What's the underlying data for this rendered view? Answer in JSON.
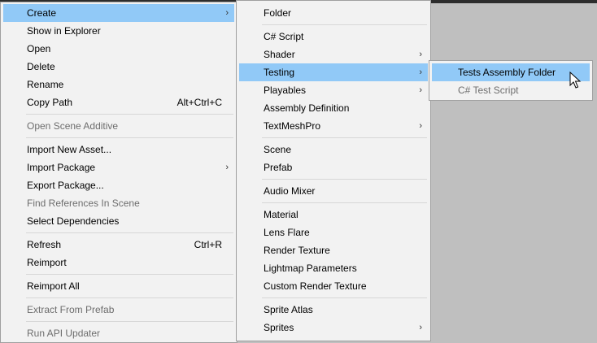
{
  "main_menu": {
    "items": [
      {
        "label": "Create",
        "arrow": "›"
      },
      {
        "label": "Show in Explorer"
      },
      {
        "label": "Open"
      },
      {
        "label": "Delete"
      },
      {
        "label": "Rename"
      },
      {
        "label": "Copy Path",
        "shortcut": "Alt+Ctrl+C"
      },
      {
        "label": "Open Scene Additive"
      },
      {
        "label": "Import New Asset..."
      },
      {
        "label": "Import Package",
        "arrow": "›"
      },
      {
        "label": "Export Package..."
      },
      {
        "label": "Find References In Scene"
      },
      {
        "label": "Select Dependencies"
      },
      {
        "label": "Refresh",
        "shortcut": "Ctrl+R"
      },
      {
        "label": "Reimport"
      },
      {
        "label": "Reimport All"
      },
      {
        "label": "Extract From Prefab"
      },
      {
        "label": "Run API Updater"
      }
    ]
  },
  "create_menu": {
    "items": [
      {
        "label": "Folder"
      },
      {
        "label": "C# Script"
      },
      {
        "label": "Shader",
        "arrow": "›"
      },
      {
        "label": "Testing",
        "arrow": "›"
      },
      {
        "label": "Playables",
        "arrow": "›"
      },
      {
        "label": "Assembly Definition"
      },
      {
        "label": "TextMeshPro",
        "arrow": "›"
      },
      {
        "label": "Scene"
      },
      {
        "label": "Prefab"
      },
      {
        "label": "Audio Mixer"
      },
      {
        "label": "Material"
      },
      {
        "label": "Lens Flare"
      },
      {
        "label": "Render Texture"
      },
      {
        "label": "Lightmap Parameters"
      },
      {
        "label": "Custom Render Texture"
      },
      {
        "label": "Sprite Atlas"
      },
      {
        "label": "Sprites",
        "arrow": "›"
      }
    ]
  },
  "testing_menu": {
    "items": [
      {
        "label": "Tests Assembly Folder"
      },
      {
        "label": "C# Test Script"
      }
    ]
  },
  "colors": {
    "highlight": "#91c9f7",
    "menu_bg": "#f2f2f2",
    "disabled_text": "#6d6d6d",
    "desktop_bg": "#bfbfbf"
  }
}
